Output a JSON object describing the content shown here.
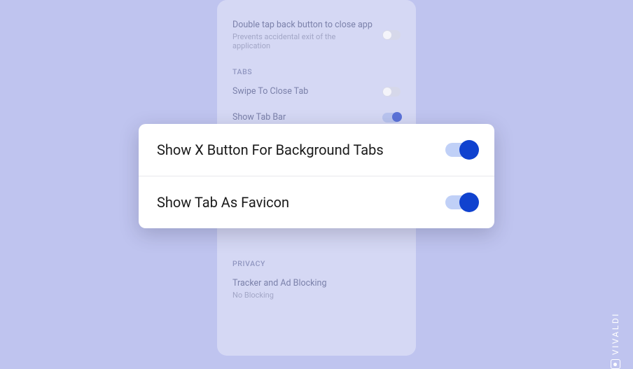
{
  "phone": {
    "double_tap": {
      "title": "Double tap back button to close app",
      "sub": "Prevents accidental exit of the application"
    },
    "tabs_header": "TABS",
    "swipe_close": {
      "title": "Swipe To Close Tab"
    },
    "show_tab_bar": {
      "title": "Show Tab Bar"
    },
    "privacy_header": "PRIVACY",
    "tracker": {
      "title": "Tracker and Ad Blocking",
      "sub": "No Blocking"
    }
  },
  "card": {
    "row1": {
      "label": "Show X Button For Background Tabs"
    },
    "row2": {
      "label": "Show Tab As Favicon"
    }
  },
  "brand": {
    "text": "VIVALDI"
  }
}
